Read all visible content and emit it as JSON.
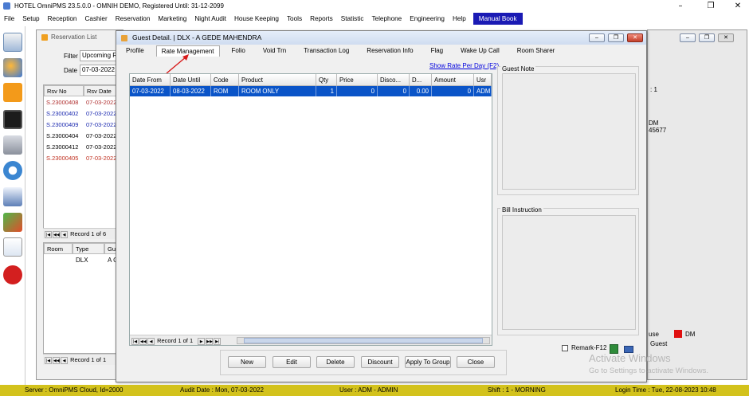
{
  "app": {
    "title": "HOTEL OmniPMS 23.5.0.0 - OMNIH DEMO, Registered Until: 31-12-2099"
  },
  "menu": [
    "File",
    "Setup",
    "Reception",
    "Cashier",
    "Reservation",
    "Marketing",
    "Night Audit",
    "House Keeping",
    "Tools",
    "Reports",
    "Statistic",
    "Telephone",
    "Engineering",
    "Help",
    "Manual Book"
  ],
  "reservation_list": {
    "title": "Reservation List",
    "filter_label": "Filter",
    "filter_value": "Upcoming Re",
    "date_label": "Date",
    "date_value": "07-03-2022",
    "columns": [
      "Rsv No",
      "Rsv Date"
    ],
    "rows": [
      {
        "no": "S.23000408",
        "date": "07-03-2022",
        "color": "#b03030"
      },
      {
        "no": "S.23000402",
        "date": "07-03-2022",
        "color": "#1c2ab0"
      },
      {
        "no": "S.23000409",
        "date": "07-03-2022",
        "color": "#1c2ab0"
      },
      {
        "no": "S.23000404",
        "date": "07-03-2022",
        "color": "#000000"
      },
      {
        "no": "S.23000412",
        "date": "07-03-2022",
        "color": "#000000"
      },
      {
        "no": "S.23000405",
        "date": "07-03-2022",
        "color": "#c03020"
      }
    ],
    "record_text": "Record 1 of 6",
    "room_columns": [
      "Room",
      "Type",
      "Gue"
    ],
    "room_row": {
      "room": "",
      "type": "DLX",
      "guest": "A G"
    },
    "room_record_text": "Record 1 of 1"
  },
  "background_window": {
    "line1": ": 1",
    "line2": "DM",
    "line3": "45677",
    "legend_use": "use",
    "legend_dm": "DM",
    "legend_guest": "Guest"
  },
  "dialog": {
    "title": "Guest Detail.  | DLX - A GEDE MAHENDRA",
    "tabs": [
      "Profile",
      "Rate Management",
      "Folio",
      "Void Trn",
      "Transaction Log",
      "Reservation Info",
      "Flag",
      "Wake Up Call",
      "Room Sharer"
    ],
    "active_tab": "Rate Management",
    "show_rate_link": "Show Rate Per Day (F2)",
    "rate_columns": [
      "Date From",
      "Date Until",
      "Code",
      "Product",
      "Qty",
      "Price",
      "Disco...",
      "D...",
      "Amount",
      "Usr"
    ],
    "rate_rows": [
      [
        "07-03-2022",
        "08-03-2022",
        "ROM",
        "ROOM ONLY",
        "1",
        "0",
        "0",
        "0.00",
        "0",
        "ADM"
      ]
    ],
    "rate_record_text": "Record 1 of 1",
    "guest_note_label": "Guest Note",
    "bill_instruction_label": "Bill Instruction",
    "remark_label": "Remark-F12",
    "buttons": [
      "New",
      "Edit",
      "Delete",
      "Discount",
      "Apply To Group",
      "Close"
    ]
  },
  "watermark": {
    "line1": "Activate Windows",
    "line2": "Go to Settings to activate Windows."
  },
  "status_bar": {
    "server": "Server : OmniPMS Cloud, Id=2000",
    "audit_date": "Audit Date : Mon, 07-03-2022",
    "user": "User : ADM - ADMIN",
    "shift": "Shift : 1 - MORNING",
    "login_time": "Login Time : Tue, 22-08-2023 10:48"
  },
  "colors": {
    "status_bar": "#d3c21c",
    "selected_row": "#0a54c8",
    "manual_book": "#1a1ab4"
  }
}
